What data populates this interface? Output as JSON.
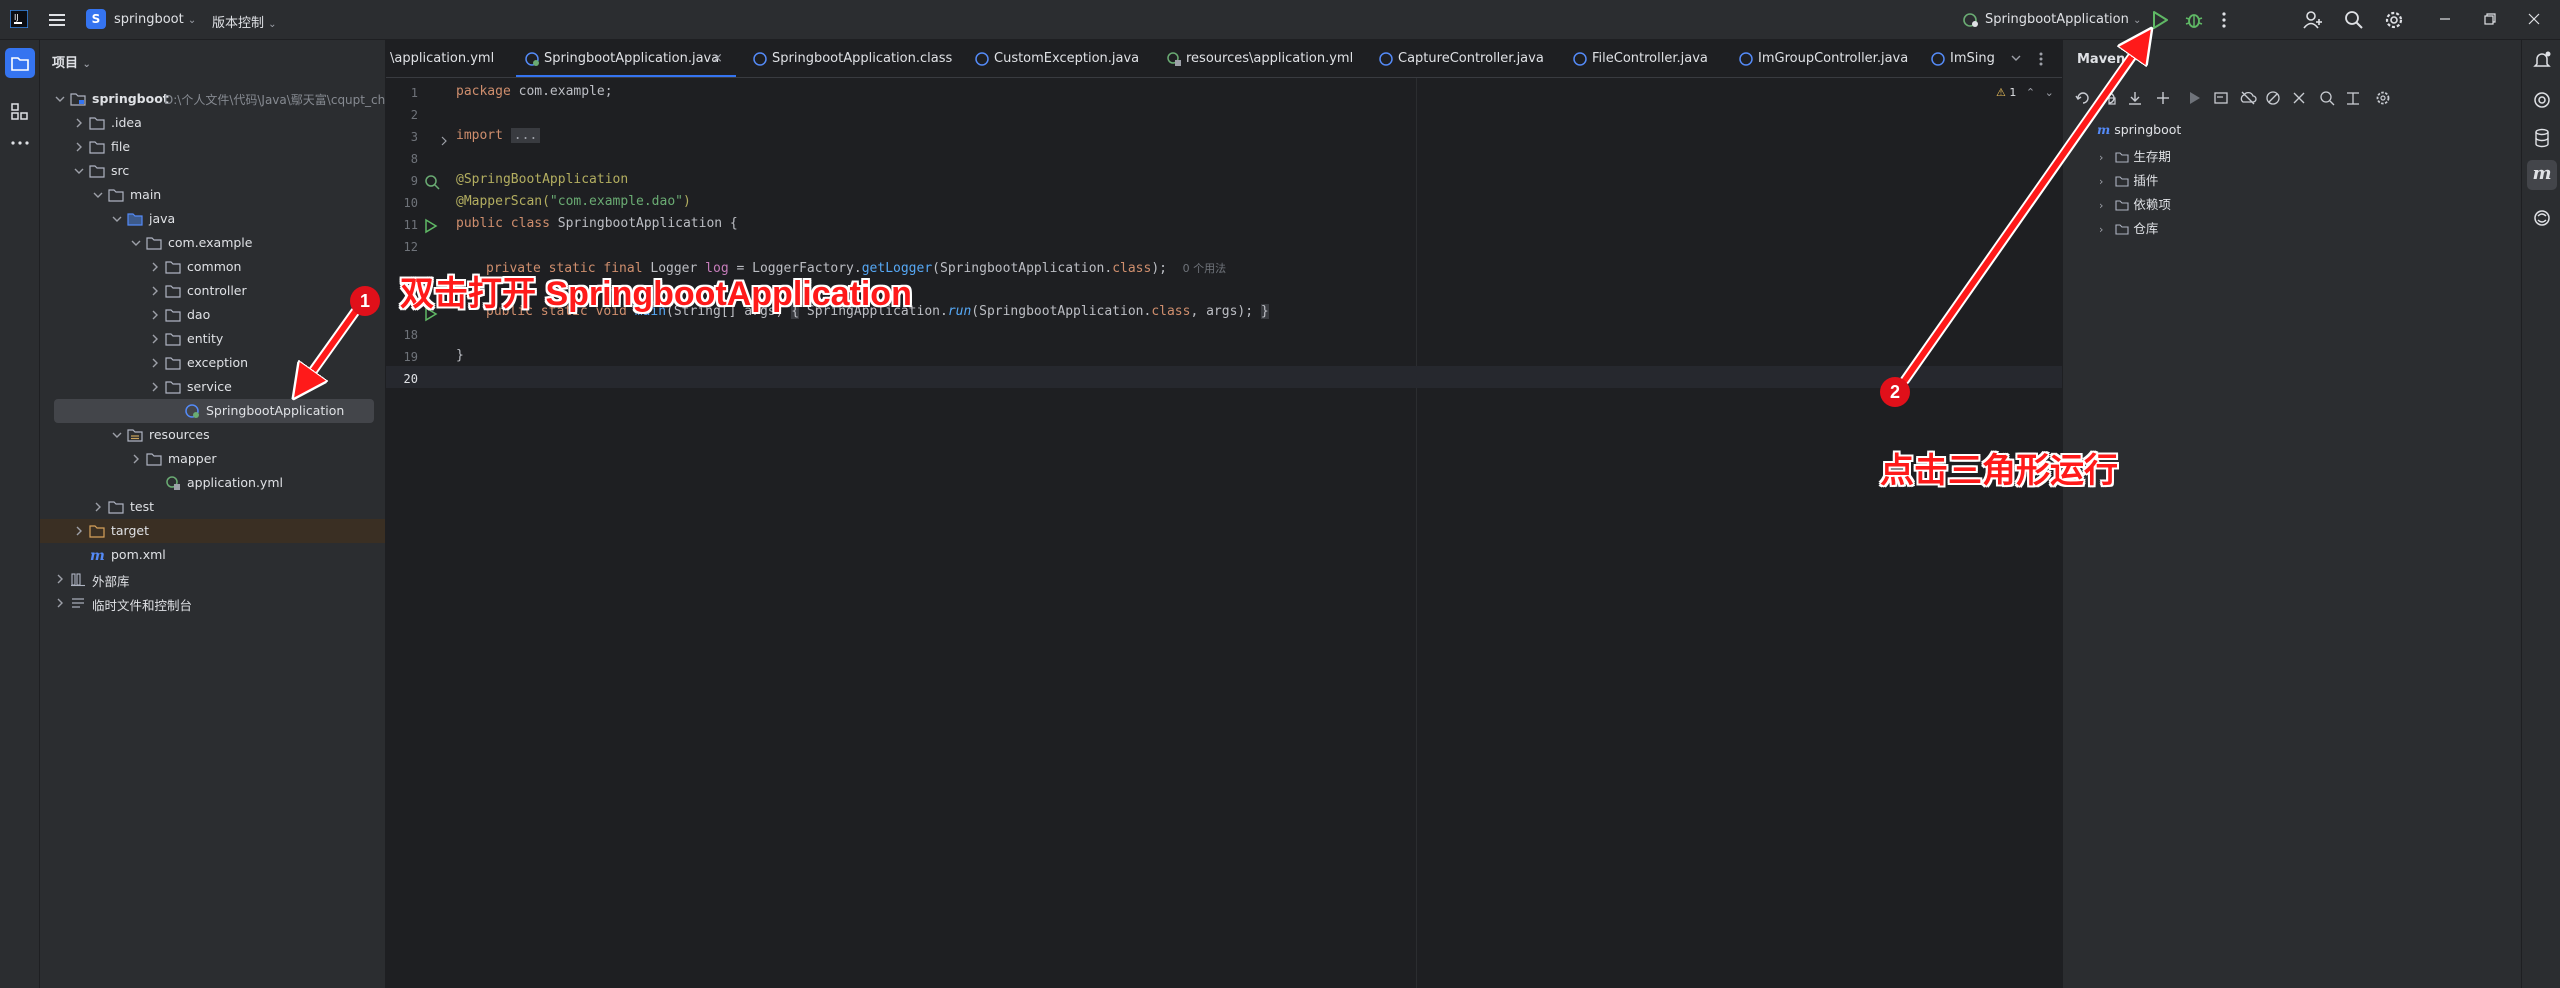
{
  "titlebar": {
    "project_badge": "S",
    "project_name": "springboot",
    "vcs_label": "版本控制",
    "run_config": "SpringbootApplication"
  },
  "project_panel": {
    "title": "项目",
    "root_label": "springboot",
    "root_path": "D:\\个人文件\\代码\\Java\\鄢天富\\cqupt_ch",
    "tree": [
      {
        "label": ".idea"
      },
      {
        "label": "file"
      },
      {
        "label": "src"
      },
      {
        "label": "main"
      },
      {
        "label": "java"
      },
      {
        "label": "com.example"
      },
      {
        "label": "common"
      },
      {
        "label": "controller"
      },
      {
        "label": "dao"
      },
      {
        "label": "entity"
      },
      {
        "label": "exception"
      },
      {
        "label": "service"
      },
      {
        "label": "SpringbootApplication"
      },
      {
        "label": "resources"
      },
      {
        "label": "mapper"
      },
      {
        "label": "application.yml"
      },
      {
        "label": "test"
      },
      {
        "label": "target"
      },
      {
        "label": "pom.xml"
      },
      {
        "label": "外部库"
      },
      {
        "label": "临时文件和控制台"
      }
    ]
  },
  "tabs": [
    {
      "label": "\\application.yml"
    },
    {
      "label": "SpringbootApplication.java",
      "close": "×"
    },
    {
      "label": "SpringbootApplication.class"
    },
    {
      "label": "CustomException.java"
    },
    {
      "label": "resources\\application.yml"
    },
    {
      "label": "CaptureController.java"
    },
    {
      "label": "FileController.java"
    },
    {
      "label": "ImGroupController.java"
    },
    {
      "label": "ImSingl"
    }
  ],
  "editor": {
    "line_numbers": [
      "1",
      "2",
      "3",
      "8",
      "9",
      "10",
      "11",
      "12",
      "",
      "",
      "",
      "18",
      "19",
      "20"
    ],
    "inspection_count": "1",
    "code": {
      "l1_kw": "package",
      "l1_rest": " com.example;",
      "l3_kw": "import",
      "l3_fold": "...",
      "l9": "@SpringBootApplication",
      "l10_ann": "@MapperScan(",
      "l10_str": "\"com.example.dao\"",
      "l10_end": ")",
      "l11_kw": "public class",
      "l11_rest": " SpringbootApplication {",
      "l13_kw": "private static final",
      "l13_type": " Logger ",
      "l13_field": "log",
      "l13_mid": " = LoggerFactory.",
      "l13_fn": "getLogger",
      "l13_arg": "(SpringbootApplication.",
      "l13_cls": "class",
      "l13_end": ");",
      "l13_hint": "0 个用法",
      "l16_kw": "public static void",
      "l16_fn": " main",
      "l16_args": "(String[] args)",
      "l16_fold": "{",
      "l16_call": " SpringApplication.",
      "l16_run": "run",
      "l16_arg": "(SpringbootApplication.",
      "l16_cls": "class",
      "l16_end": ", args);",
      "l16_close": "}",
      "l19": "}"
    }
  },
  "maven": {
    "title": "Maven",
    "root": "springboot",
    "items": [
      "生存期",
      "插件",
      "依赖项",
      "仓库"
    ]
  },
  "annotations": {
    "note1": "双击打开 SpringbootApplication",
    "note2": "点击三角形运行",
    "badge1": "1",
    "badge2": "2"
  }
}
